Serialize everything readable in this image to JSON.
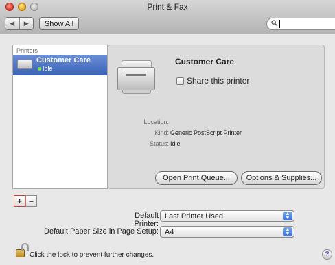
{
  "window": {
    "title": "Print & Fax"
  },
  "toolbar": {
    "back_glyph": "◀",
    "forward_glyph": "▶",
    "show_all_label": "Show All",
    "search_placeholder": "",
    "search_icon": "magnifier-icon"
  },
  "printers_list": {
    "header": "Printers",
    "items": [
      {
        "name": "Customer Care",
        "status": "Idle",
        "status_color": "#7adf50",
        "selected": true
      }
    ]
  },
  "detail": {
    "printer_name": "Customer Care",
    "share_label": "Share this printer",
    "share_checked": false,
    "info": [
      {
        "label": "Location:",
        "value": ""
      },
      {
        "label": "Kind:",
        "value": "Generic PostScript Printer"
      },
      {
        "label": "Status:",
        "value": "Idle"
      }
    ],
    "open_queue_label": "Open Print Queue...",
    "options_label": "Options & Supplies..."
  },
  "list_controls": {
    "add_label": "+",
    "remove_label": "−"
  },
  "defaults": {
    "default_printer_label": "Default Printer:",
    "default_printer_value": "Last Printer Used",
    "paper_size_label": "Default Paper Size in Page Setup:",
    "paper_size_value": "A4"
  },
  "footer": {
    "lock_text": "Click the lock to prevent further changes.",
    "help_glyph": "?"
  },
  "colors": {
    "selection_blue": "#3a62b6",
    "highlight_red": "#d63a2e",
    "popup_arrow_blue": "#3a6fd0"
  }
}
